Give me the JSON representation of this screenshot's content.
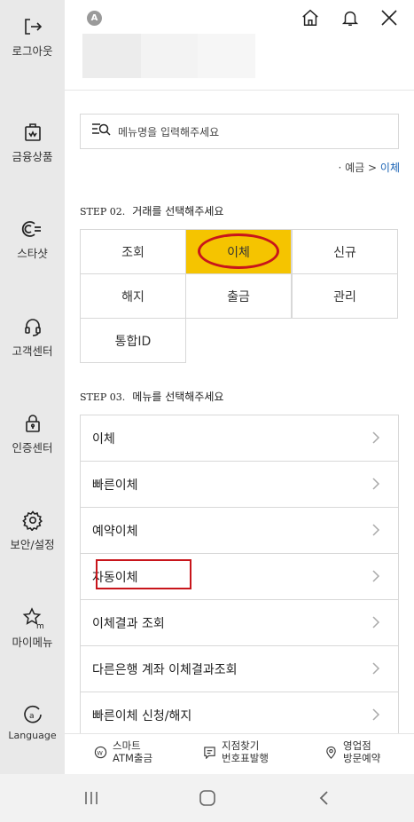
{
  "sidebar": {
    "items": [
      {
        "label": "로그아웃",
        "icon": "logout-icon"
      },
      {
        "label": "금융상품",
        "icon": "financial-product-icon"
      },
      {
        "label": "스타샷",
        "icon": "starshot-icon"
      },
      {
        "label": "고객센터",
        "icon": "headset-icon"
      },
      {
        "label": "인증센터",
        "icon": "lock-icon"
      },
      {
        "label": "보안/설정",
        "icon": "gear-icon"
      },
      {
        "label": "마이메뉴",
        "icon": "star-m-icon"
      },
      {
        "label": "Language",
        "icon": "language-icon"
      }
    ]
  },
  "header": {
    "avatar_letter": "A"
  },
  "search": {
    "placeholder": "메뉴명을 입력해주세요"
  },
  "breadcrumb": {
    "prefix": "· 예금 > ",
    "current": "이체"
  },
  "step2": {
    "num": "STEP 02.",
    "title": "거래를 선택해주세요",
    "options": [
      "조회",
      "이체",
      "신규",
      "해지",
      "출금",
      "관리",
      "통합ID"
    ],
    "selected": "이체"
  },
  "step3": {
    "num": "STEP 03.",
    "title": "메뉴를 선택해주세요",
    "items": [
      "이체",
      "빠른이체",
      "예약이체",
      "자동이체",
      "이체결과 조회",
      "다른은행 계좌 이체결과조회",
      "빠른이체 신청/해지"
    ]
  },
  "bottom_links": [
    {
      "line1": "스마트",
      "line2": "ATM출금",
      "icon": "atm-icon"
    },
    {
      "line1": "지점찾기",
      "line2": "번호표발행",
      "icon": "ticket-icon"
    },
    {
      "line1": "영업점",
      "line2": "방문예약",
      "icon": "location-pin-icon"
    }
  ],
  "colors": {
    "accent_yellow": "#f5c400",
    "highlight_red": "#c8151b",
    "link_blue": "#1a63b5",
    "sidebar_bg": "#e9e9e9"
  }
}
